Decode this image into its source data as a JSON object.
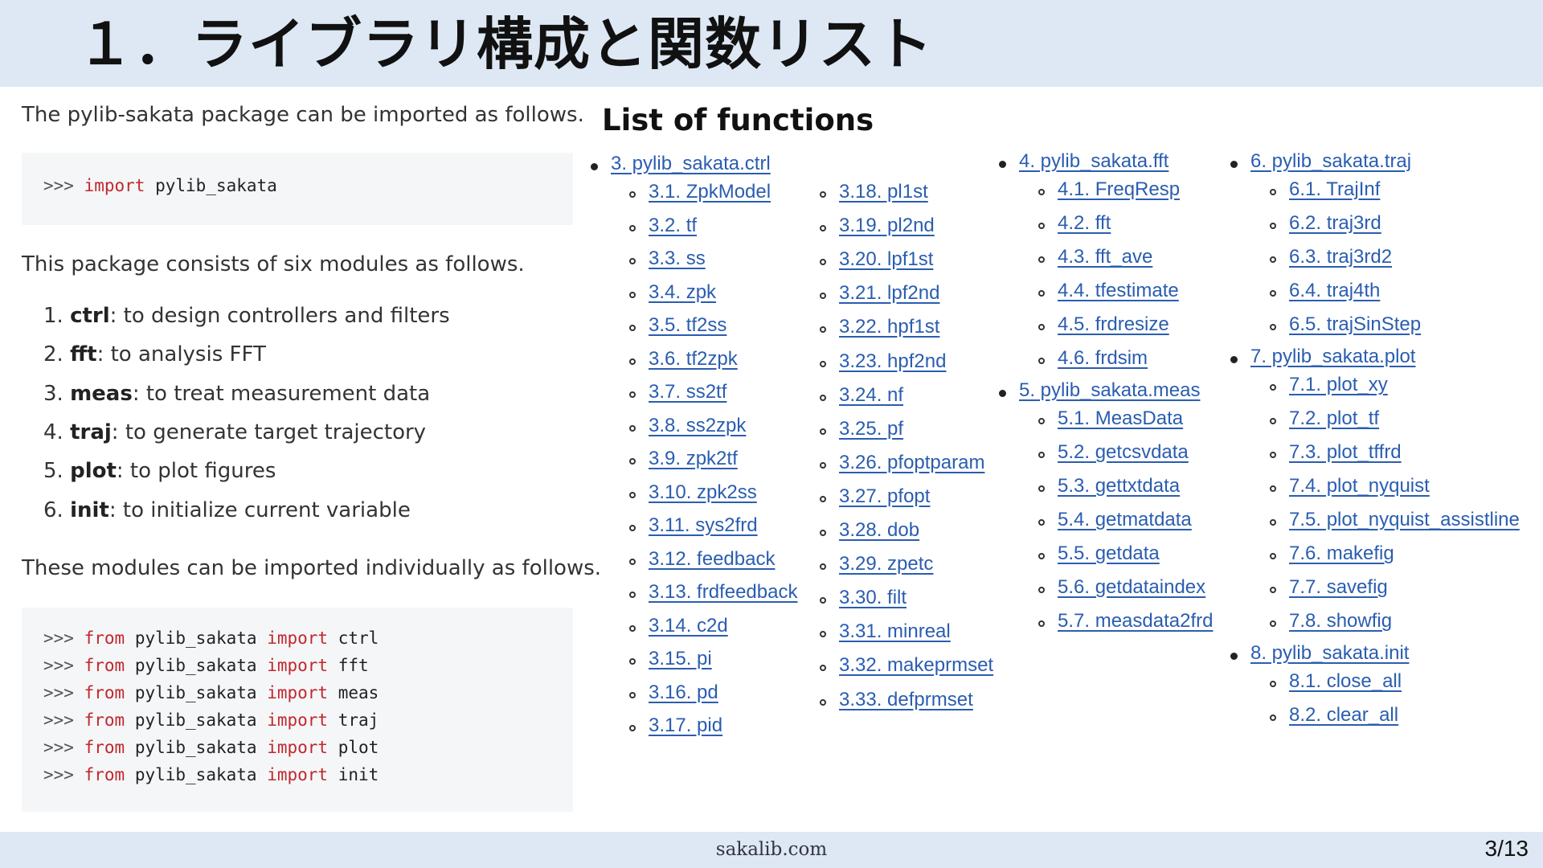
{
  "header": {
    "title": "１．ライブラリ構成と関数リスト"
  },
  "left": {
    "intro": "The pylib-sakata package can be imported as follows.",
    "code1": {
      "prompt": ">>>",
      "kw": "import",
      "rest": " pylib_sakata"
    },
    "modules_intro": "This package consists of six modules as follows.",
    "modules": [
      {
        "num": "1.",
        "name": "ctrl",
        "desc": ": to design controllers and filters"
      },
      {
        "num": "2.",
        "name": "fft",
        "desc": ": to analysis FFT"
      },
      {
        "num": "3.",
        "name": "meas",
        "desc": ": to treat measurement data"
      },
      {
        "num": "4.",
        "name": "traj",
        "desc": ": to generate target trajectory"
      },
      {
        "num": "5.",
        "name": "plot",
        "desc": ": to plot figures"
      },
      {
        "num": "6.",
        "name": "init",
        "desc": ": to initialize current variable"
      }
    ],
    "individual_intro": "These modules can be imported individually as follows.",
    "code2": {
      "prompt": ">>>",
      "from": "from",
      "pkg": " pylib_sakata ",
      "import": "import",
      "mods": [
        " ctrl",
        " fft",
        " meas",
        " traj",
        " plot",
        " init"
      ]
    }
  },
  "functions": {
    "title": "List of functions",
    "col1": {
      "head": "3. pylib_sakata.ctrl",
      "items": [
        "3.1. ZpkModel",
        "3.2. tf",
        "3.3. ss",
        "3.4. zpk",
        "3.5. tf2ss",
        "3.6. tf2zpk",
        "3.7. ss2tf",
        "3.8. ss2zpk",
        "3.9. zpk2tf",
        "3.10. zpk2ss",
        "3.11. sys2frd",
        "3.12. feedback",
        "3.13. frdfeedback",
        "3.14. c2d",
        "3.15. pi",
        "3.16. pd",
        "3.17. pid"
      ]
    },
    "col2": {
      "items": [
        "3.18. pl1st",
        "3.19. pl2nd",
        "3.20. lpf1st",
        "3.21. lpf2nd",
        "3.22. hpf1st",
        "3.23. hpf2nd",
        "3.24. nf",
        "3.25. pf",
        "3.26. pfoptparam",
        "3.27. pfopt",
        "3.28. dob",
        "3.29. zpetc",
        "3.30. filt",
        "3.31. minreal",
        "3.32. makeprmset",
        "3.33. defprmset"
      ]
    },
    "col3": {
      "groups": [
        {
          "head": "4. pylib_sakata.fft",
          "items": [
            "4.1. FreqResp",
            "4.2. fft",
            "4.3. fft_ave",
            "4.4. tfestimate",
            "4.5. frdresize",
            "4.6. frdsim"
          ]
        },
        {
          "head": "5. pylib_sakata.meas",
          "items": [
            "5.1. MeasData",
            "5.2. getcsvdata",
            "5.3. gettxtdata",
            "5.4. getmatdata",
            "5.5. getdata",
            "5.6. getdataindex",
            "5.7. measdata2frd"
          ]
        }
      ]
    },
    "col4": {
      "groups": [
        {
          "head": "6. pylib_sakata.traj",
          "items": [
            "6.1. TrajInf",
            "6.2. traj3rd",
            "6.3. traj3rd2",
            "6.4. traj4th",
            "6.5. trajSinStep"
          ]
        },
        {
          "head": "7. pylib_sakata.plot",
          "items": [
            "7.1. plot_xy",
            "7.2. plot_tf",
            "7.3. plot_tffrd",
            "7.4. plot_nyquist",
            "7.5. plot_nyquist_assistline",
            "7.6. makefig",
            "7.7. savefig",
            "7.8. showfig"
          ]
        },
        {
          "head": "8. pylib_sakata.init",
          "items": [
            "8.1. close_all",
            "8.2. clear_all"
          ]
        }
      ]
    }
  },
  "footer": {
    "site": "sakalib.com",
    "page": "3/13"
  }
}
